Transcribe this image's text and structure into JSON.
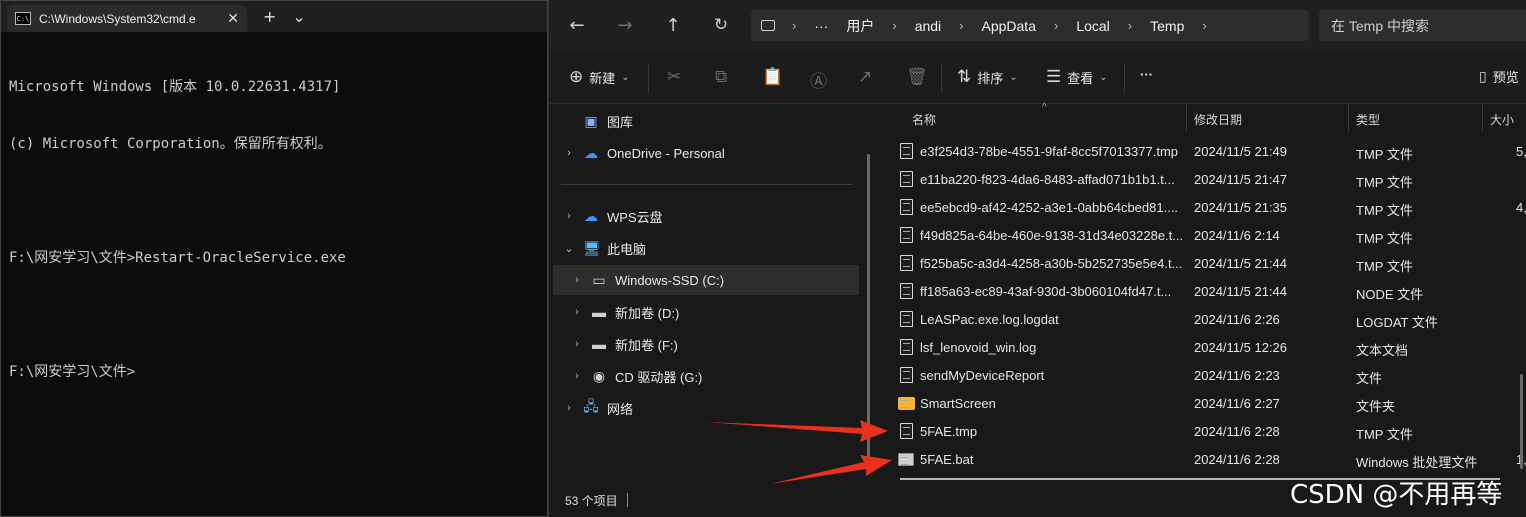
{
  "cmd": {
    "tab_title": "C:\\Windows\\System32\\cmd.e",
    "close_glyph": "✕",
    "new_tab_glyph": "+",
    "dropdown_glyph": "⌄",
    "lines": [
      "Microsoft Windows [版本 10.0.22631.4317]",
      "(c) Microsoft Corporation。保留所有权利。",
      "",
      "F:\\网安学习\\文件>Restart-OracleService.exe",
      "",
      "F:\\网安学习\\文件>"
    ]
  },
  "explorer": {
    "address": [
      "用户",
      "andi",
      "AppData",
      "Local",
      "Temp"
    ],
    "address_more": "···",
    "search_placeholder": "在 Temp 中搜索",
    "toolbar": {
      "new_label": "新建",
      "sort_label": "排序",
      "view_label": "查看",
      "more_label": "···",
      "preview_label": "预览"
    },
    "sidebar": [
      {
        "label": "图库",
        "icon": "gallery-icon"
      },
      {
        "label": "OneDrive - Personal",
        "icon": "cloud-icon"
      },
      {
        "label": "WPS云盘",
        "icon": "cloud-icon"
      },
      {
        "label": "此电脑",
        "icon": "computer-icon"
      },
      {
        "label": "Windows-SSD (C:)",
        "icon": "drive-icon"
      },
      {
        "label": "新加卷 (D:)",
        "icon": "drive-icon"
      },
      {
        "label": "新加卷 (F:)",
        "icon": "drive-icon"
      },
      {
        "label": "CD 驱动器 (G:)",
        "icon": "cd-drive-icon"
      },
      {
        "label": "网络",
        "icon": "network-icon"
      }
    ],
    "columns": [
      "名称",
      "修改日期",
      "类型",
      "大小"
    ],
    "files": [
      {
        "name": "e3f254d3-78be-4551-9faf-8cc5f7013377.tmp",
        "date": "2024/11/5 21:49",
        "type": "TMP 文件",
        "size": "5,"
      },
      {
        "name": "e11ba220-f823-4da6-8483-affad071b1b1.t...",
        "date": "2024/11/5 21:47",
        "type": "TMP 文件",
        "size": ""
      },
      {
        "name": "ee5ebcd9-af42-4252-a3e1-0abb64cbed81....",
        "date": "2024/11/5 21:35",
        "type": "TMP 文件",
        "size": "4,"
      },
      {
        "name": "f49d825a-64be-460e-9138-31d34e03228e.t...",
        "date": "2024/11/6 2:14",
        "type": "TMP 文件",
        "size": ""
      },
      {
        "name": "f525ba5c-a3d4-4258-a30b-5b252735e5e4.t...",
        "date": "2024/11/5 21:44",
        "type": "TMP 文件",
        "size": ""
      },
      {
        "name": "ff185a63-ec89-43af-930d-3b060104fd47.t...",
        "date": "2024/11/5 21:44",
        "type": "NODE 文件",
        "size": ""
      },
      {
        "name": "LeASPac.exe.log.logdat",
        "date": "2024/11/6 2:26",
        "type": "LOGDAT 文件",
        "size": ""
      },
      {
        "name": "lsf_lenovoid_win.log",
        "date": "2024/11/5 12:26",
        "type": "文本文档",
        "size": ""
      },
      {
        "name": "sendMyDeviceReport",
        "date": "2024/11/6 2:23",
        "type": "文件",
        "size": ""
      },
      {
        "name": "SmartScreen",
        "date": "2024/11/6 2:27",
        "type": "文件夹",
        "size": ""
      },
      {
        "name": "5FAE.tmp",
        "date": "2024/11/6 2:28",
        "type": "TMP 文件",
        "size": ""
      },
      {
        "name": "5FAE.bat",
        "date": "2024/11/6 2:28",
        "type": "Windows 批处理文件",
        "size": "1,"
      }
    ],
    "status_count": "53 个项目"
  },
  "watermark": "CSDN @不用再等"
}
